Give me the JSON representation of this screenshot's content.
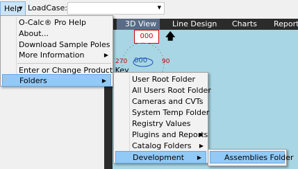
{
  "toolbar": {
    "help_label": "Help",
    "loadcase_label": "LoadCase:"
  },
  "tabs": [
    {
      "label": "3D View",
      "active": true
    },
    {
      "label": "Line Design"
    },
    {
      "label": "Charts"
    },
    {
      "label": "Reports"
    }
  ],
  "view": {
    "gauge_top": "000",
    "gauge_center": "000",
    "dial_left": "270",
    "dial_right": "90"
  },
  "help_menu": [
    {
      "label": "O-Calc® Pro Help"
    },
    {
      "label": "About..."
    },
    {
      "label": "Download Sample Poles"
    },
    {
      "label": "More Information"
    },
    {
      "label": "Enter or Change Product Key"
    },
    {
      "label": "Folders"
    }
  ],
  "folders_menu": [
    {
      "label": "User Root Folder"
    },
    {
      "label": "All Users Root Folder"
    },
    {
      "label": "Cameras and CVTs"
    },
    {
      "label": "System Temp Folder"
    },
    {
      "label": "Registry Values"
    },
    {
      "label": "Plugins and Reports"
    },
    {
      "label": "Catalog Folders"
    },
    {
      "label": "Development"
    }
  ],
  "development_menu": [
    {
      "label": "Assemblies Folder"
    }
  ]
}
